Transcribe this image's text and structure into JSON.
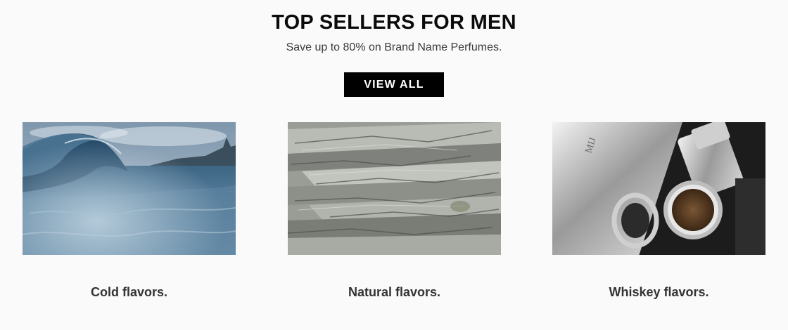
{
  "section": {
    "title": "TOP SELLERS FOR MEN",
    "subtitle": "Save up to 80% on Brand Name Perfumes.",
    "view_all_label": "VIEW ALL"
  },
  "cards": [
    {
      "label": "Cold flavors.",
      "image": "ocean-wave-photo"
    },
    {
      "label": "Natural flavors.",
      "image": "tree-bark-photo"
    },
    {
      "label": "Whiskey flavors.",
      "image": "whiskey-flask-photo"
    }
  ],
  "colors": {
    "button_bg": "#000000",
    "button_text": "#ffffff",
    "background": "#fafafa"
  }
}
